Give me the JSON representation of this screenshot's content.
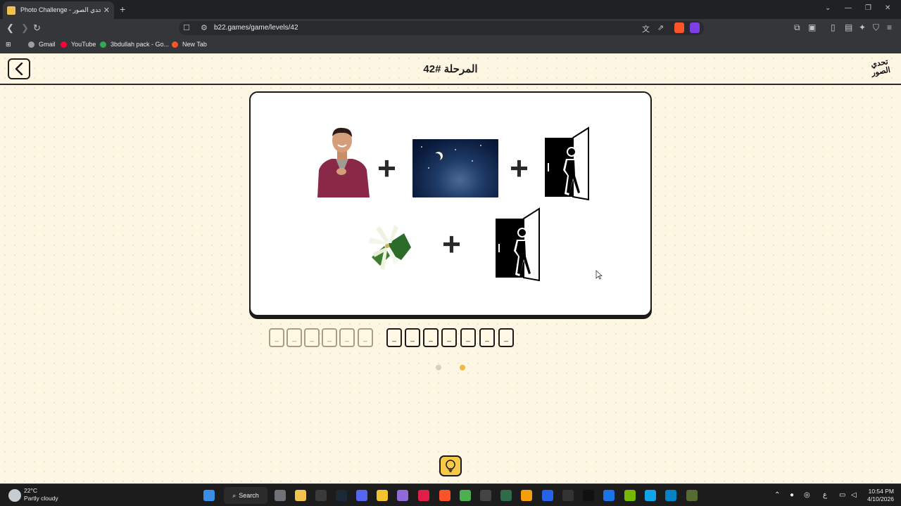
{
  "browser": {
    "tab_title": "Photo Challenge - لعبة تحدي الصور",
    "tab_close": "✕",
    "new_tab": "+",
    "url": "b22.games/game/levels/42",
    "bookmarks": [
      {
        "label": "Gmail",
        "color": "#9aa0a6"
      },
      {
        "label": "YouTube",
        "color": "#ff0033"
      },
      {
        "label": "3bdullah pack - Go...",
        "color": "#34a853"
      },
      {
        "label": "New Tab",
        "color": "#fb542b"
      }
    ],
    "window_controls": {
      "chevron": "⌄",
      "minimize": "—",
      "restore": "❐",
      "close": "✕"
    }
  },
  "game": {
    "level_title": "المرحلة #42",
    "logo_text": "تحدي الصور",
    "operators": [
      "+",
      "+",
      "+"
    ],
    "word1_slots": [
      "_",
      "_",
      "_",
      "_",
      "_",
      "_"
    ],
    "word2_slots": [
      "_",
      "_",
      "_",
      "_",
      "_",
      "_",
      "_"
    ],
    "progress_dots": [
      {
        "color": "#d6d0bd"
      },
      {
        "color": "#f2b740"
      }
    ]
  },
  "taskbar": {
    "temperature": "22°C",
    "condition": "Partly cloudy",
    "search_label": "Search",
    "time": "10:54 PM",
    "date": "4/10/2026",
    "lang": "ع"
  },
  "colors": {
    "page_bg": "#fdf6e2",
    "accent": "#f7c948",
    "ink": "#1b1b1b"
  }
}
